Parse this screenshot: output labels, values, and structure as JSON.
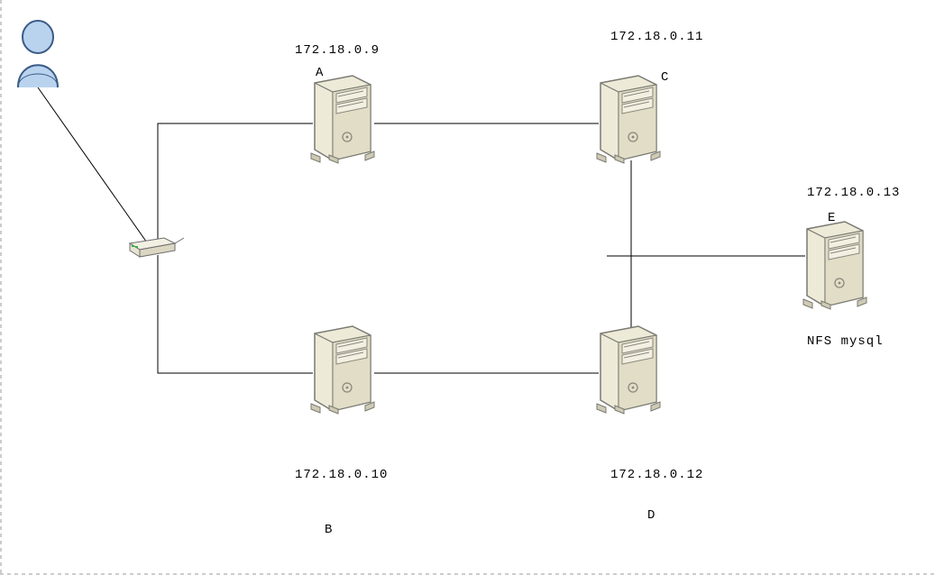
{
  "nodes": {
    "A": {
      "ip": "172.18.0.9",
      "letter": "A"
    },
    "B": {
      "ip": "172.18.0.10",
      "letter": "B"
    },
    "C": {
      "ip": "172.18.0.11",
      "letter": "C"
    },
    "D": {
      "ip": "172.18.0.12",
      "letter": "D"
    },
    "E": {
      "ip": "172.18.0.13",
      "letter": "E",
      "caption": "NFS mysql"
    }
  }
}
